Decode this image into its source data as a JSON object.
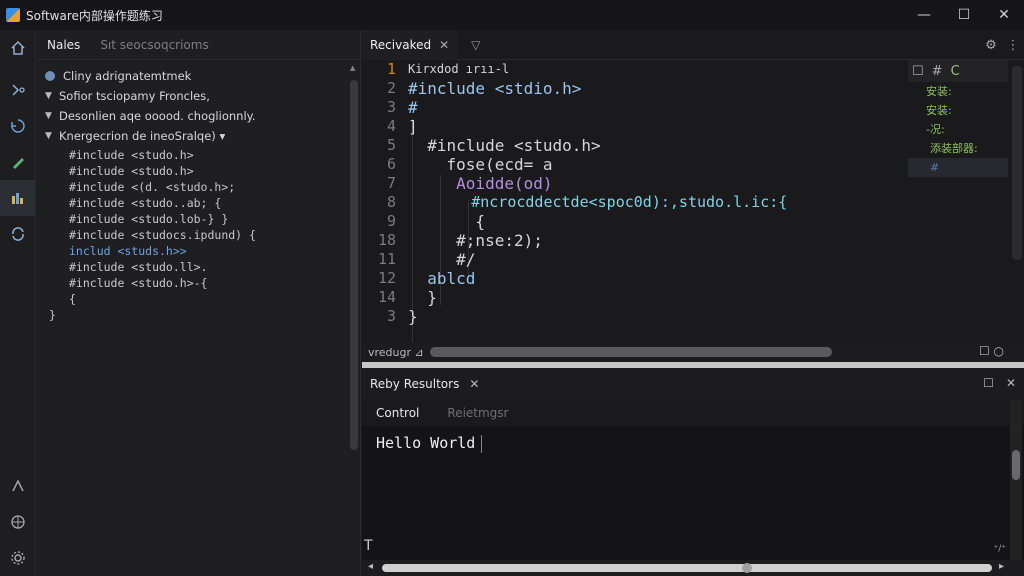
{
  "titlebar": {
    "title": "Software内部操作题练习",
    "minimize": "—",
    "maximize": "☐",
    "close": "✕"
  },
  "activity": {
    "icons": [
      "home-icon",
      "git-icon",
      "history-icon",
      "pen-icon",
      "extensions-icon",
      "sync-icon",
      "share-icon",
      "globe-icon",
      "settings-icon"
    ]
  },
  "sidebar": {
    "tab_active": "Nales",
    "tab_inactive": "Sıt seocsoqcrioms",
    "tree": [
      {
        "label": "Cliny adrignatemtmek",
        "type": "root"
      },
      {
        "label": "Sofior tsciopamy Froncles,",
        "type": "folder"
      },
      {
        "label": "Desonlien aqe ooood. choglionnly.",
        "type": "folder"
      },
      {
        "label": "Knergecrion de ineoSralqe) ▾",
        "type": "folder"
      }
    ],
    "code_lines": [
      {
        "text": "#include <studo.h>",
        "style": ""
      },
      {
        "text": "#include <studo.h>",
        "style": ""
      },
      {
        "text": "#include <(d. <studo.h>;",
        "style": ""
      },
      {
        "text": "#include <studo..ab; {",
        "style": ""
      },
      {
        "text": "#include <studo.lob-}       }",
        "style": ""
      },
      {
        "text": "#include <studocs.ipdund) {",
        "style": ""
      },
      {
        "text": "includ <studs.h>>",
        "style": "blue"
      },
      {
        "text": "#include <studo.ll>.",
        "style": ""
      },
      {
        "text": "#include <studo.h>-{",
        "style": ""
      },
      {
        "text": "  {",
        "style": ""
      },
      {
        "text": "}",
        "style": ""
      }
    ]
  },
  "editor": {
    "tab_label": "Recivaked",
    "tab_close": "✕",
    "filter": "▽",
    "actions": [
      "⚙",
      "⋮"
    ],
    "line_numbers": [
      "1",
      "2",
      "3",
      "4",
      "5",
      "6",
      "7",
      "8",
      "9",
      "18",
      "11",
      "12",
      "14",
      "3"
    ],
    "lines": [
      {
        "text": "Kirxdod ırıı-l",
        "cls": "small"
      },
      {
        "text": "#include <stdio.h>",
        "cls": "c-inc"
      },
      {
        "text": "#",
        "cls": "c-inc"
      },
      {
        "text": "]",
        "cls": ""
      },
      {
        "text": "  #include <studo.h>",
        "cls": ""
      },
      {
        "text": "    fose(ecd= a",
        "cls": ""
      },
      {
        "text": "     Aoidde(od)",
        "cls": "c-purple"
      },
      {
        "text": "       #ncrocddectde<spoc0d):,studo.l.ic:{",
        "cls": "c-cyan"
      },
      {
        "text": "       {",
        "cls": ""
      },
      {
        "text": "     #;nse:2);",
        "cls": ""
      },
      {
        "text": "     #/",
        "cls": ""
      },
      {
        "text": "  ablcd",
        "cls": "c-inc"
      },
      {
        "text": "  }",
        "cls": ""
      },
      {
        "text": "}",
        "cls": ""
      }
    ],
    "minimap_tools": [
      "☐",
      "#",
      "C"
    ],
    "minimap_lines": [
      "安装:",
      "安装:",
      "-况:",
      "添装部器:",
      "#"
    ],
    "status_label": "vredugr ⊿",
    "status_icons": "☐ ○"
  },
  "panel": {
    "title": "Reby Resultors",
    "close": "✕",
    "actions": [
      "☐",
      "✕"
    ],
    "tab_active": "Control",
    "tab_inactive": "Reietmgsr",
    "output": "Hello World",
    "left_icon": "T",
    "corner": "⁺/⁺",
    "scroll_left": "◂",
    "scroll_right": "▸"
  }
}
